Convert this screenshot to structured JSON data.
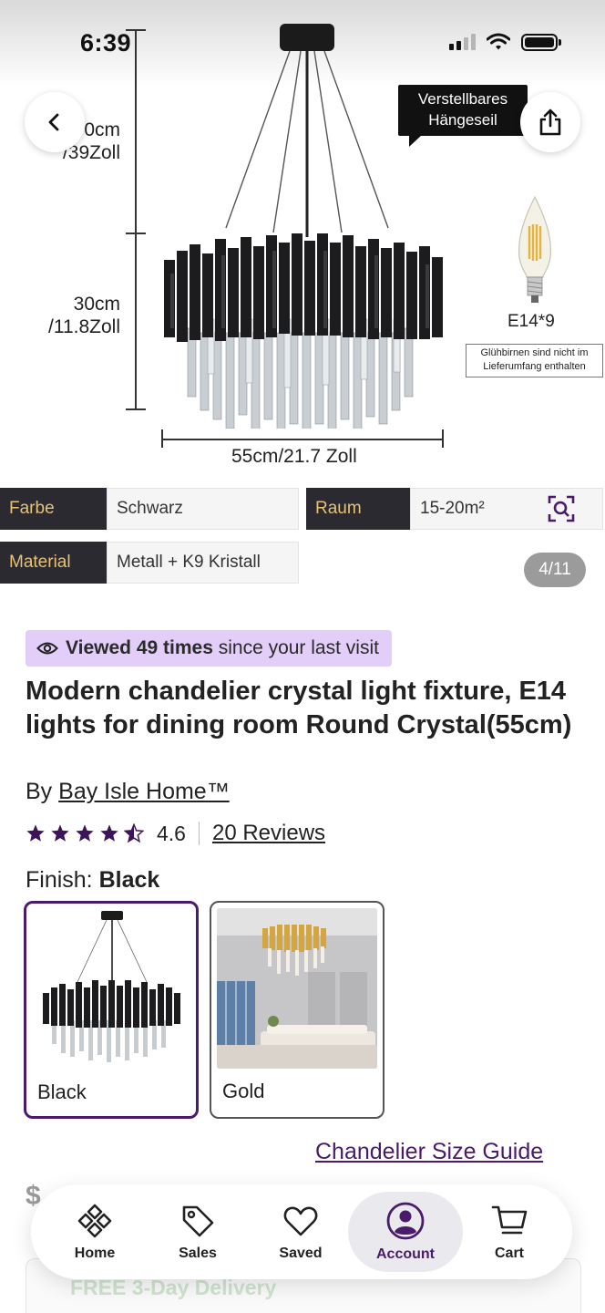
{
  "status_bar": {
    "time": "6:39"
  },
  "hero": {
    "height_label_top": "0cm\n/39Zoll",
    "height_label_mid": "30cm\n/11.8Zoll",
    "width_label": "55cm/21.7 Zoll",
    "callout": "Verstellbares\nHängeseil",
    "bulb_label": "E14*9",
    "bulb_note": "Glühbirnen sind nicht im Lieferumfang enthalten",
    "specs": [
      {
        "key": "Farbe",
        "value": "Schwarz"
      },
      {
        "key": "Raum",
        "value": "15-20m²"
      },
      {
        "key": "Material",
        "value": "Metall + K9 Kristall"
      }
    ],
    "image_counter": "4/11"
  },
  "product": {
    "viewed": {
      "bold": "Viewed 49 times",
      "rest": "since your last visit"
    },
    "title": "Modern chandelier crystal light fixture, E14 lights for dining room Round Crystal(55cm)",
    "brand_prefix": "By",
    "brand": "Bay Isle Home™",
    "rating": 4.6,
    "rating_text": "4.6",
    "reviews_link": "20 Reviews",
    "finish_prefix": "Finish:",
    "finish_selected": "Black",
    "finishes": [
      "Black",
      "Gold"
    ],
    "size_guide": "Chandelier Size Guide",
    "price_partial": "$",
    "delivery": "FREE 3-Day Delivery"
  },
  "nav": {
    "items": [
      {
        "label": "Home",
        "icon": "home-icon"
      },
      {
        "label": "Sales",
        "icon": "tag-icon"
      },
      {
        "label": "Saved",
        "icon": "heart-icon"
      },
      {
        "label": "Account",
        "icon": "account-icon",
        "active": true
      },
      {
        "label": "Cart",
        "icon": "cart-icon"
      }
    ]
  },
  "colors": {
    "brand_purple": "#4a1a6b",
    "badge_lilac": "#e3cdf9",
    "spec_key_bg": "#2a2a30",
    "spec_key_text": "#e6c27a"
  }
}
